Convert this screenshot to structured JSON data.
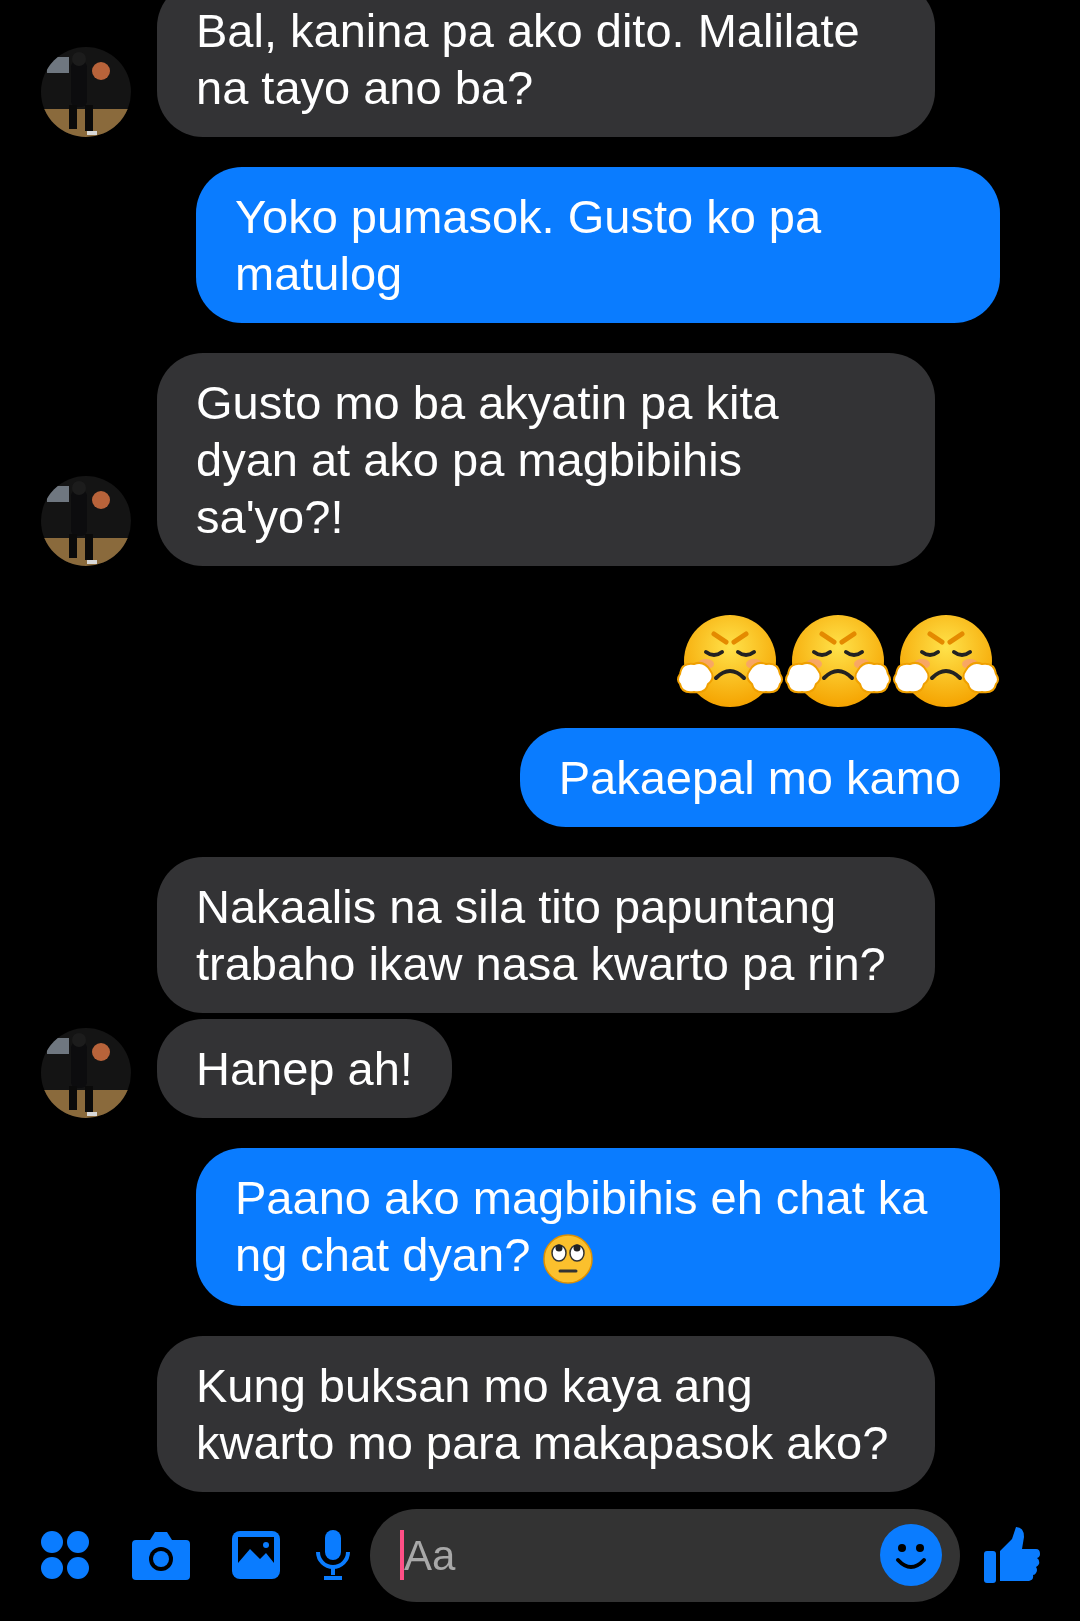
{
  "groups": [
    {
      "kind": "incoming",
      "avatar": true,
      "messages": [
        {
          "kind": "text",
          "lines": [
            "Bal, kanina pa ako dito. Malilate",
            "na tayo ano ba?"
          ]
        }
      ]
    },
    {
      "kind": "outgoing",
      "messages": [
        {
          "kind": "text",
          "lines": [
            "Yoko pumasok. Gusto ko pa",
            "matulog"
          ]
        }
      ]
    },
    {
      "kind": "incoming",
      "avatar": true,
      "messages": [
        {
          "kind": "text",
          "lines": [
            "Gusto mo ba akyatin pa kita",
            "dyan at ako pa magbibihis",
            "sa'yo?!"
          ]
        }
      ]
    },
    {
      "kind": "outgoing",
      "messages": [
        {
          "kind": "emoji",
          "emojis": [
            {
              "kind": "steam"
            },
            {
              "kind": "steam"
            },
            {
              "kind": "steam"
            }
          ]
        },
        {
          "kind": "text",
          "lines": [
            "Pakaepal mo kamo"
          ]
        }
      ]
    },
    {
      "kind": "incoming",
      "avatar": true,
      "messages": [
        {
          "kind": "text",
          "lines": [
            "Nakaalis na sila tito papuntang",
            "trabaho ikaw nasa kwarto pa rin?"
          ]
        },
        {
          "kind": "text",
          "lines": [
            "Hanep ah!"
          ]
        }
      ]
    },
    {
      "kind": "outgoing",
      "messages": [
        {
          "kind": "text",
          "lines": [
            "Paano ako magbibihis eh chat ka",
            "ng chat dyan?"
          ],
          "trailing_emoji": {
            "kind": "eye-roll"
          }
        }
      ]
    },
    {
      "kind": "incoming",
      "avatar": false,
      "messages": [
        {
          "kind": "text",
          "lines": [
            "Kung buksan mo kaya ang",
            "kwarto mo para makapasok ako?"
          ]
        }
      ]
    }
  ],
  "composer": {
    "placeholder": "Aa"
  }
}
